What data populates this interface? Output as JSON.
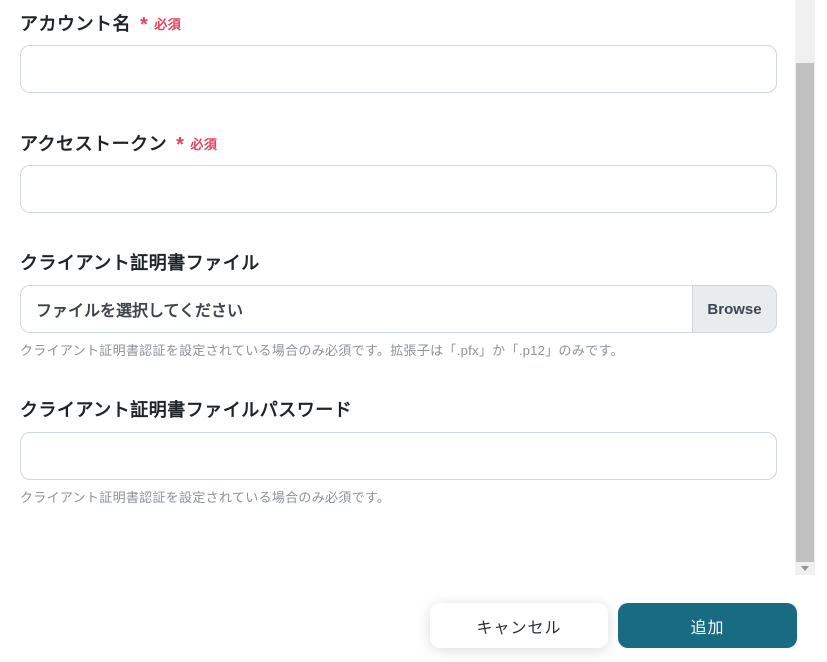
{
  "form": {
    "fields": [
      {
        "label": "アカウント名",
        "asterisk": "*",
        "required_badge": "必須",
        "value": ""
      },
      {
        "label": "アクセストークン",
        "asterisk": "*",
        "required_badge": "必須",
        "value": ""
      },
      {
        "label": "クライアント証明書ファイル",
        "placeholder": "ファイルを選択してください",
        "browse_label": "Browse",
        "helper": "クライアント証明書認証を設定されている場合のみ必須です。拡張子は「.pfx」か「.p12」のみです。"
      },
      {
        "label": "クライアント証明書ファイルパスワード",
        "value": "",
        "helper": "クライアント証明書認証を設定されている場合のみ必須です。"
      }
    ]
  },
  "footer": {
    "cancel_label": "キャンセル",
    "submit_label": "追加"
  },
  "colors": {
    "primary_button_bg": "#176c82",
    "required_red": "#df455d",
    "label_text": "#1f2428",
    "helper_text": "#8b9299",
    "input_border": "#d0d7de",
    "browse_bg": "#e9ecef",
    "scrollbar_thumb": "#c1c1c1",
    "scrollbar_track": "#f0f0f1"
  }
}
